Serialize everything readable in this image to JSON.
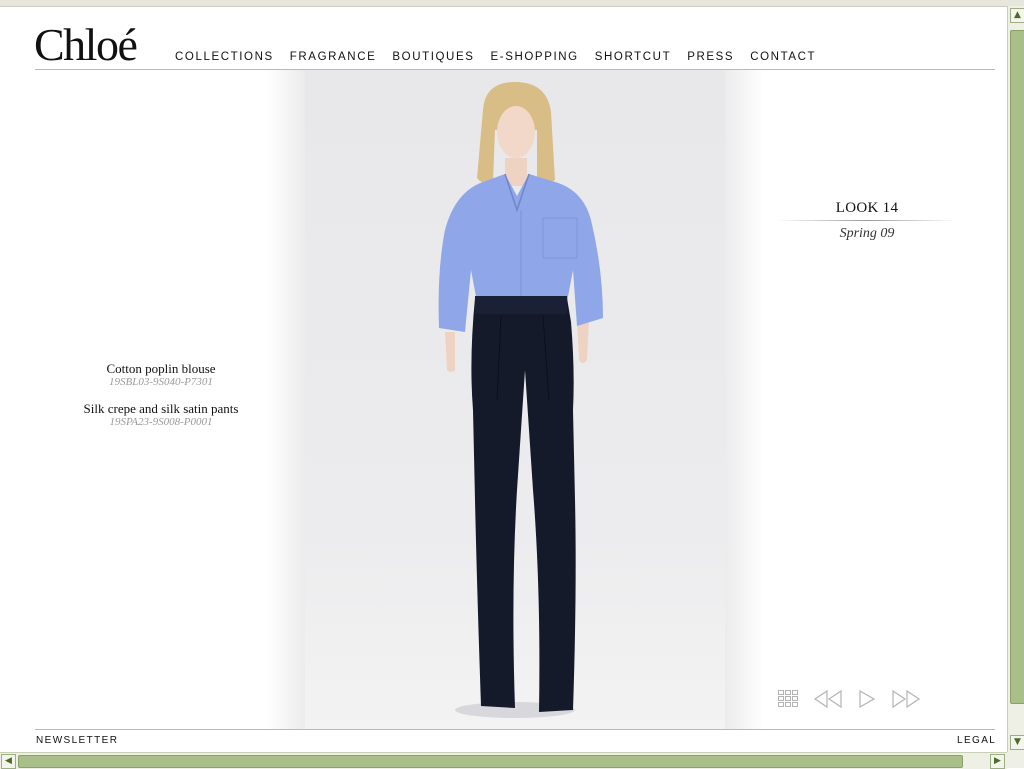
{
  "brand": {
    "logo_text": "Chloé"
  },
  "nav": {
    "items": [
      {
        "label": "COLLECTIONS"
      },
      {
        "label": "FRAGRANCE"
      },
      {
        "label": "BOUTIQUES"
      },
      {
        "label": "E-SHOPPING"
      },
      {
        "label": "SHORTCUT"
      },
      {
        "label": "PRESS"
      },
      {
        "label": "CONTACT"
      }
    ]
  },
  "garments": [
    {
      "name": "Cotton poplin blouse",
      "code": "19SBL03-9S040-P7301"
    },
    {
      "name": "Silk crepe and silk satin pants",
      "code": "19SPA23-9S008-P0001"
    }
  ],
  "look": {
    "title": "LOOK 14",
    "season": "Spring 09"
  },
  "controls": {
    "icons": [
      "grid-view-icon",
      "previous-icon",
      "play-icon",
      "next-icon"
    ]
  },
  "footer": {
    "left_link": "NEWSLETTER",
    "right_link": "LEGAL"
  },
  "colors": {
    "text": "#111111",
    "code_gray": "#9a9a9a",
    "shirt_blue": "#8fa6e8",
    "pants_navy": "#151a2a",
    "scrollbar_green": "#a9bf8a"
  }
}
